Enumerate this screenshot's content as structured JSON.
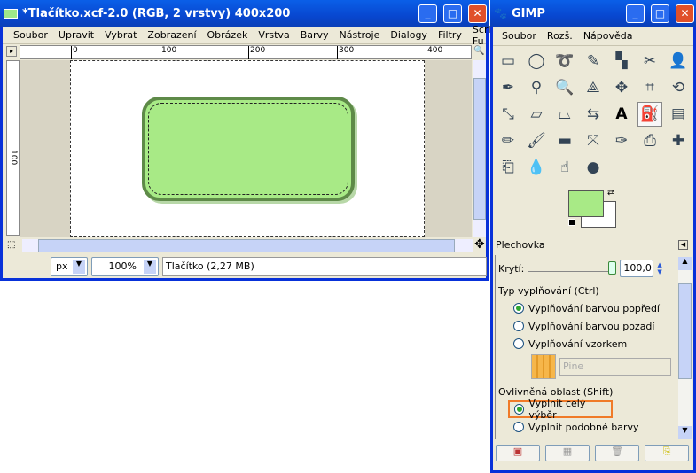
{
  "image_window": {
    "title": "*Tlačítko.xcf-2.0 (RGB, 2 vrstvy) 400x200",
    "menu": [
      "Soubor",
      "Upravit",
      "Vybrat",
      "Zobrazení",
      "Obrázek",
      "Vrstva",
      "Barvy",
      "Nástroje",
      "Dialogy",
      "Filtry",
      "Script-Fu"
    ],
    "ruler_labels": [
      "0",
      "100",
      "200",
      "300",
      "400"
    ],
    "vruler_label": "100",
    "unit": "px",
    "zoom": "100%",
    "status": "Tlačítko (2,27 MB)"
  },
  "toolbox": {
    "title": "GIMP",
    "menu": [
      "Soubor",
      "Rozš.",
      "Nápověda"
    ],
    "tools": [
      "rect-select",
      "ellipse-select",
      "free-select",
      "fuzzy-select",
      "color-select",
      "scissors",
      "foreground-select",
      "paths",
      "color-picker",
      "zoom",
      "measure",
      "move",
      "crop",
      "rotate",
      "scale",
      "shear",
      "perspective",
      "flip",
      "text",
      "bucket-fill",
      "blend",
      "pencil",
      "paintbrush",
      "eraser",
      "airbrush",
      "ink",
      "clone",
      "heal",
      "perspective-clone",
      "blur",
      "smudge",
      "dodge-burn"
    ],
    "fg_color": "#a8ea86",
    "bg_color": "#ffffff"
  },
  "tool_options": {
    "title": "Plechovka",
    "opacity_label": "Krytí:",
    "opacity_value": "100,0",
    "opacity": 100,
    "fill_type_label": "Typ vyplňování  (Ctrl)",
    "fill_types": [
      "Vyplňování barvou popředí",
      "Vyplňování barvou pozadí",
      "Vyplňování vzorkem"
    ],
    "fill_type_selected": 0,
    "pattern_name": "Pine",
    "area_label": "Ovlivněná oblast  (Shift)",
    "areas": [
      "Vyplnit celý výběr",
      "Vyplnit podobné barvy"
    ],
    "area_selected": 0,
    "highlight_color": "#f07a28"
  }
}
